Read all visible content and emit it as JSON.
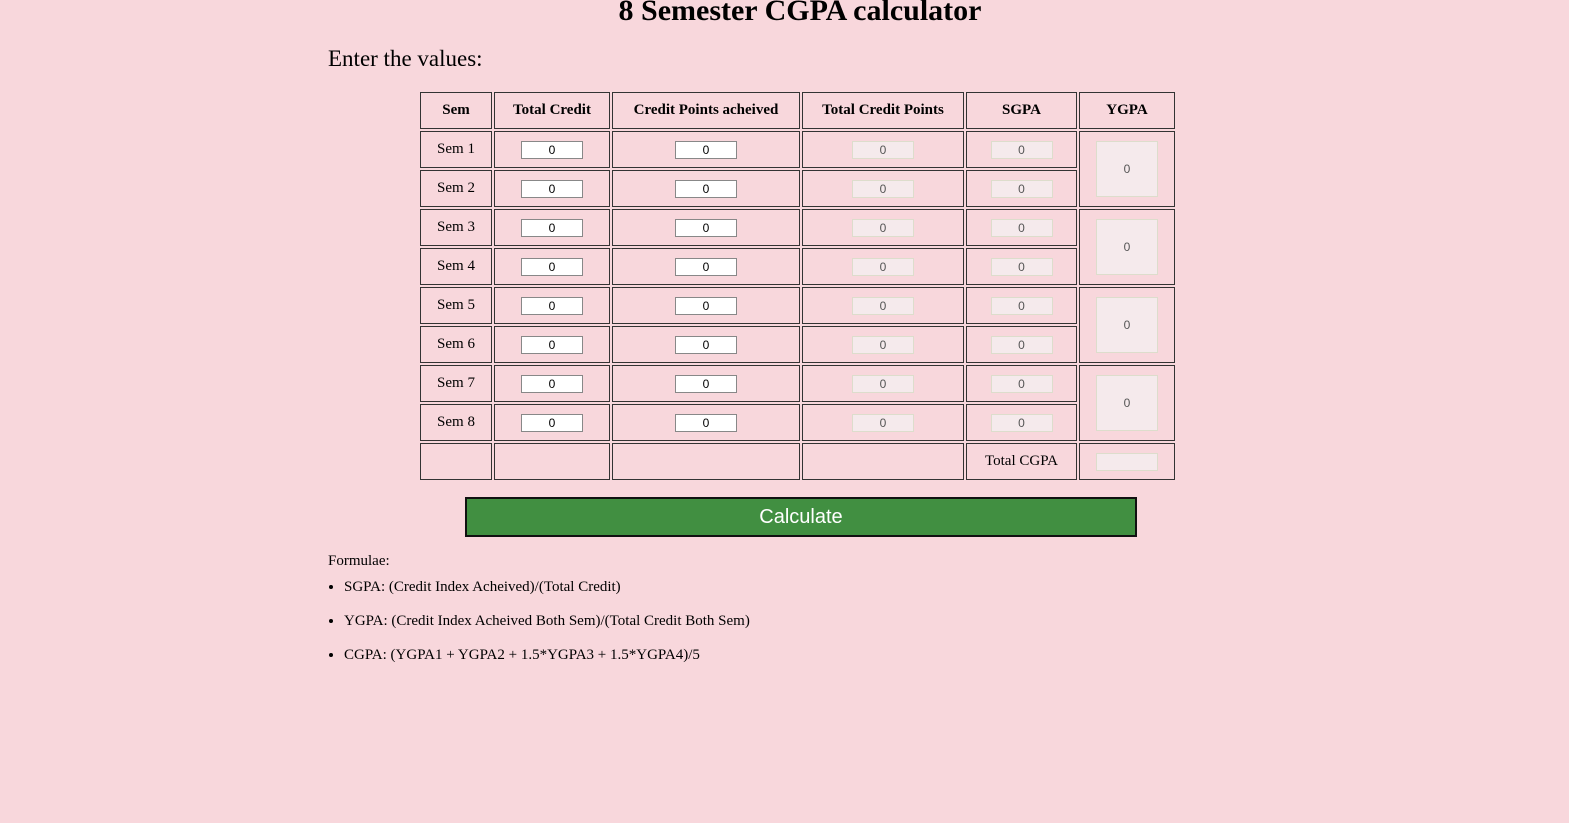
{
  "title": "8 Semester CGPA calculator",
  "subtitle": "Enter the values:",
  "table": {
    "headers": [
      "Sem",
      "Total Credit",
      "Credit Points acheived",
      "Total Credit Points",
      "SGPA",
      "YGPA"
    ],
    "rows": [
      {
        "sem": "Sem 1",
        "total_credit": "0",
        "credit_points": "0",
        "total_credit_points": "0",
        "sgpa": "0"
      },
      {
        "sem": "Sem 2",
        "total_credit": "0",
        "credit_points": "0",
        "total_credit_points": "0",
        "sgpa": "0"
      },
      {
        "sem": "Sem 3",
        "total_credit": "0",
        "credit_points": "0",
        "total_credit_points": "0",
        "sgpa": "0"
      },
      {
        "sem": "Sem 4",
        "total_credit": "0",
        "credit_points": "0",
        "total_credit_points": "0",
        "sgpa": "0"
      },
      {
        "sem": "Sem 5",
        "total_credit": "0",
        "credit_points": "0",
        "total_credit_points": "0",
        "sgpa": "0"
      },
      {
        "sem": "Sem 6",
        "total_credit": "0",
        "credit_points": "0",
        "total_credit_points": "0",
        "sgpa": "0"
      },
      {
        "sem": "Sem 7",
        "total_credit": "0",
        "credit_points": "0",
        "total_credit_points": "0",
        "sgpa": "0"
      },
      {
        "sem": "Sem 8",
        "total_credit": "0",
        "credit_points": "0",
        "total_credit_points": "0",
        "sgpa": "0"
      }
    ],
    "ygpa": [
      "0",
      "0",
      "0",
      "0"
    ],
    "total_cgpa_label": "Total CGPA",
    "total_cgpa": ""
  },
  "calculate_label": "Calculate",
  "formulae_label": "Formulae:",
  "formulae": [
    "SGPA: (Credit Index Acheived)/(Total Credit)",
    "YGPA: (Credit Index Acheived Both Sem)/(Total Credit Both Sem)",
    "CGPA: (YGPA1 + YGPA2 + 1.5*YGPA3 + 1.5*YGPA4)/5"
  ],
  "colors": {
    "background": "#f8d7dc",
    "button": "#418f41"
  }
}
